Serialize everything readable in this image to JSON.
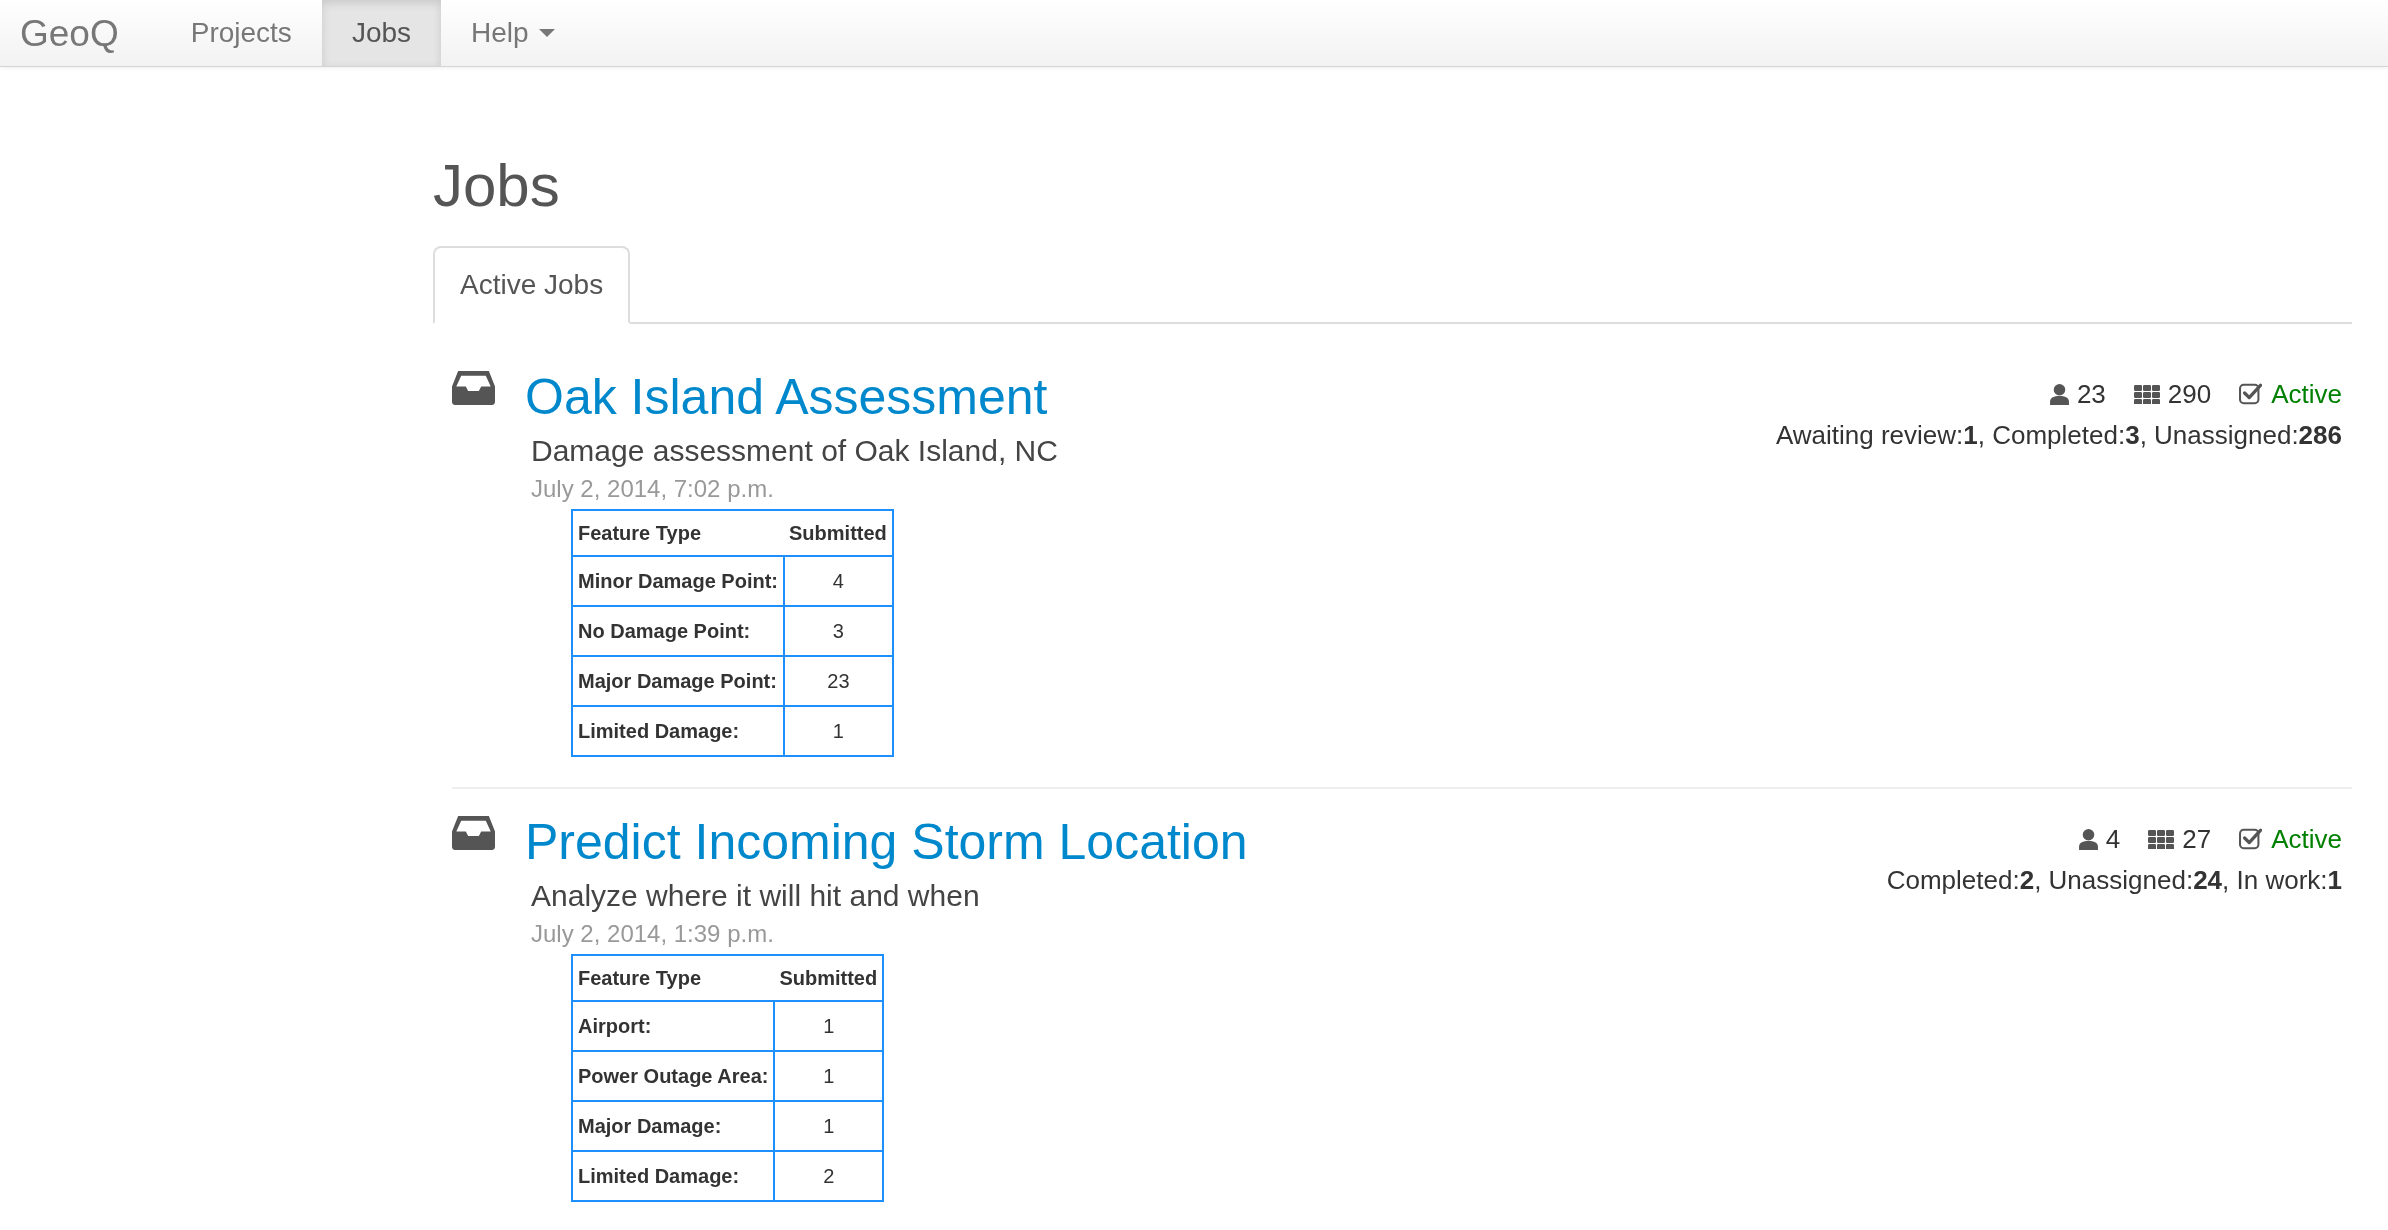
{
  "navbar": {
    "brand": "GeoQ",
    "items": [
      {
        "label": "Projects",
        "selected": false,
        "dropdown": false
      },
      {
        "label": "Jobs",
        "selected": true,
        "dropdown": false
      },
      {
        "label": "Help",
        "selected": false,
        "dropdown": true
      }
    ]
  },
  "page_title": "Jobs",
  "tabs": [
    {
      "label": "Active Jobs",
      "selected": true
    }
  ],
  "jobs": [
    {
      "title": "Oak Island Assessment",
      "description": "Damage assessment of Oak Island, NC",
      "date": "July 2, 2014, 7:02 p.m.",
      "user_count": "23",
      "grid_count": "290",
      "status": "Active",
      "progress": "Awaiting review:**1**, Completed:**3**, Unassigned:**286**",
      "table": {
        "columns": [
          "Feature Type",
          "Submitted"
        ],
        "rows": [
          [
            "Minor Damage Point:",
            "4"
          ],
          [
            "No Damage Point:",
            "3"
          ],
          [
            "Major Damage Point:",
            "23"
          ],
          [
            "Limited Damage:",
            "1"
          ]
        ]
      }
    },
    {
      "title": "Predict Incoming Storm Location",
      "description": "Analyze where it will hit and when",
      "date": "July 2, 2014, 1:39 p.m.",
      "user_count": "4",
      "grid_count": "27",
      "status": "Active",
      "progress": "Completed:**2**, Unassigned:**24**, In work:**1**",
      "table": {
        "columns": [
          "Feature Type",
          "Submitted"
        ],
        "rows": [
          [
            "Airport:",
            "1"
          ],
          [
            "Power Outage Area:",
            "1"
          ],
          [
            "Major Damage:",
            "1"
          ],
          [
            "Limited Damage:",
            "2"
          ]
        ]
      }
    }
  ]
}
